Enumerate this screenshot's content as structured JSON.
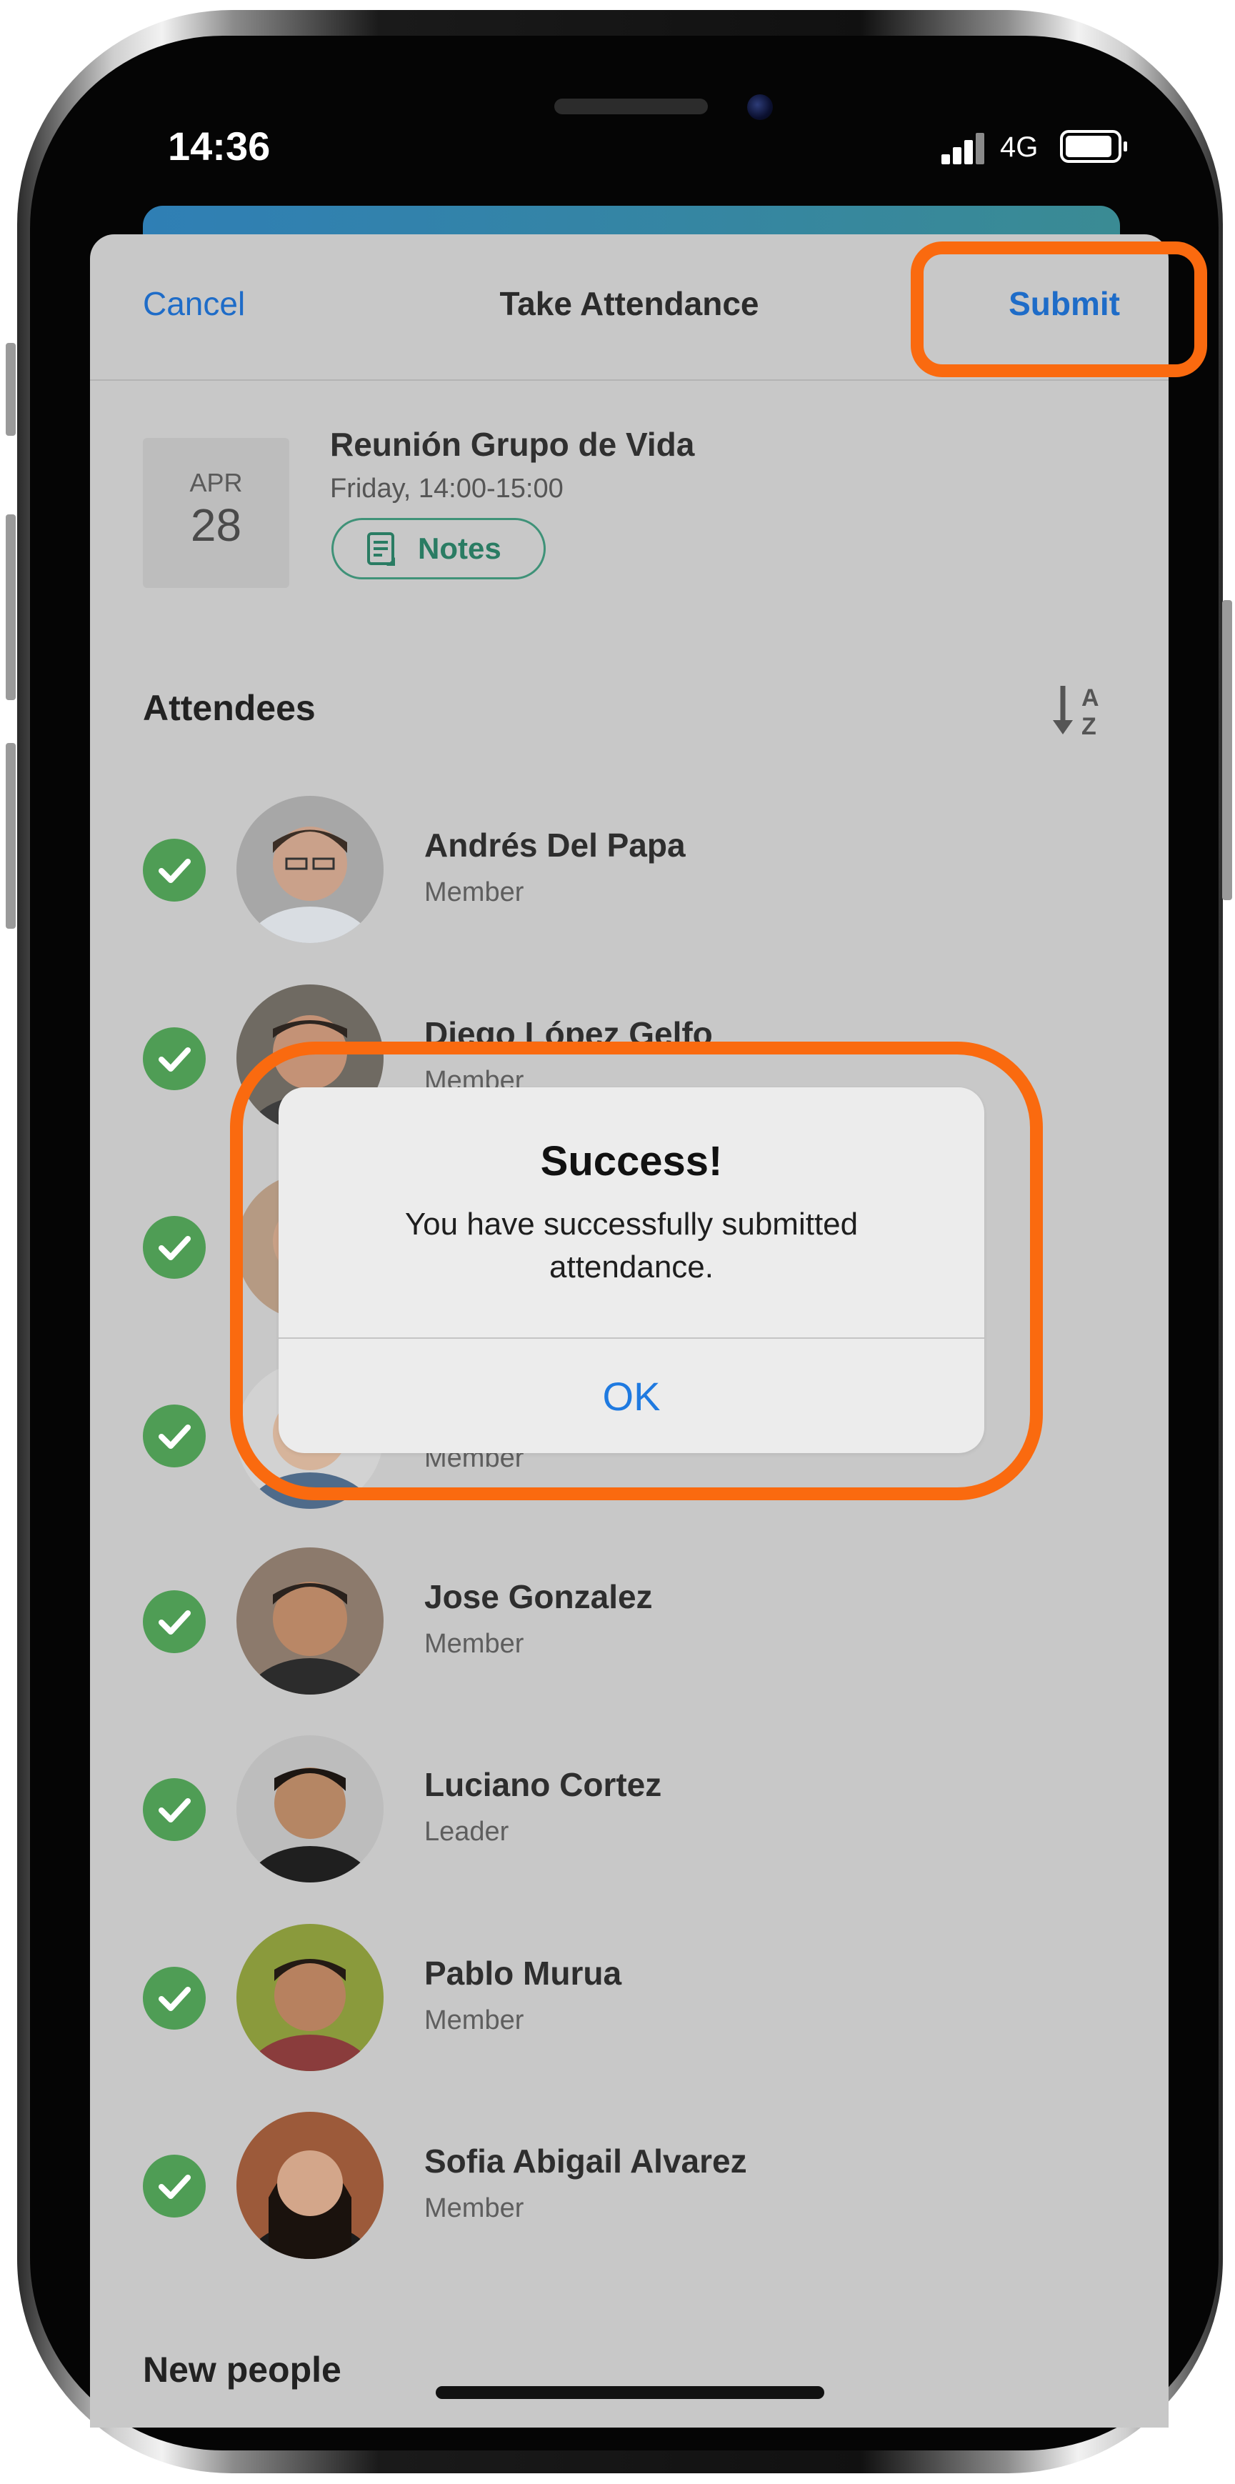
{
  "status_bar": {
    "time": "14:36",
    "network": "4G",
    "icons": [
      "signal-icon",
      "battery-icon"
    ]
  },
  "header": {
    "cancel_label": "Cancel",
    "title": "Take Attendance",
    "submit_label": "Submit"
  },
  "event": {
    "month": "APR",
    "day": "28",
    "title": "Reunión Grupo de Vida",
    "time": "Friday, 14:00-15:00",
    "notes_label": "Notes"
  },
  "attendees": {
    "heading": "Attendees",
    "sort_icon": "sort-a-z-icon",
    "list": [
      {
        "name": "Andrés Del Papa",
        "role": "Member",
        "checked": true
      },
      {
        "name": "Diego López Gelfo",
        "role": "Member",
        "checked": true
      },
      {
        "name": "",
        "role": "",
        "checked": true
      },
      {
        "name": "",
        "role": "Member",
        "checked": true
      },
      {
        "name": "Jose Gonzalez",
        "role": "Member",
        "checked": true
      },
      {
        "name": "Luciano Cortez",
        "role": "Leader",
        "checked": true
      },
      {
        "name": "Pablo Murua",
        "role": "Member",
        "checked": true
      },
      {
        "name": "Sofia Abigail Alvarez",
        "role": "Member",
        "checked": true
      }
    ]
  },
  "new_people": {
    "heading": "New people"
  },
  "alert": {
    "title": "Success!",
    "message": "You have successfully submitted attendance.",
    "ok_label": "OK"
  },
  "colors": {
    "accent_blue": "#1e6cc8",
    "check_green": "#4f9d55",
    "notes_green": "#3f9278",
    "highlight_orange": "#fa6a0f"
  }
}
